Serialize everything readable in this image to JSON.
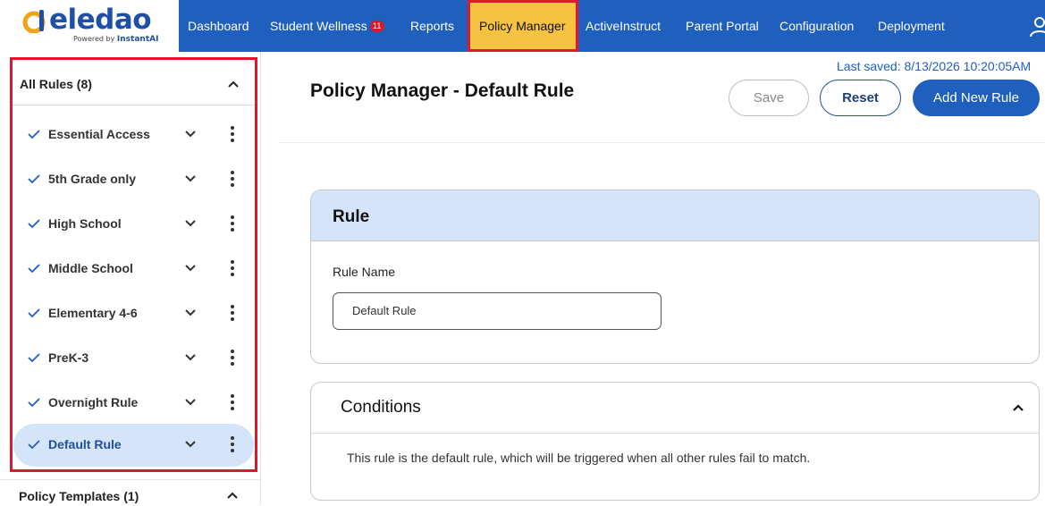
{
  "brand": {
    "name": "eledao",
    "powered_by_prefix": "Powered by",
    "powered_by_name": "InstantAI",
    "logo_icon": "eledao-logo-icon",
    "accent_color": "#1f5fbe",
    "logo_orange": "#f0a21b"
  },
  "nav": {
    "items": [
      {
        "label": "Dashboard"
      },
      {
        "label": "Student Wellness",
        "badge": "11"
      },
      {
        "label": "Reports"
      },
      {
        "label": "Policy Manager",
        "active": true
      },
      {
        "label": "ActiveInstruct"
      },
      {
        "label": "Parent Portal"
      },
      {
        "label": "Configuration"
      },
      {
        "label": "Deployment"
      }
    ],
    "user_icon": "user-icon",
    "active_bg": "#f5c242",
    "active_border": "#e0182d"
  },
  "sidebar": {
    "rules_title": "All Rules (8)",
    "rules": [
      {
        "label": "Essential Access"
      },
      {
        "label": "5th Grade only"
      },
      {
        "label": "High School"
      },
      {
        "label": "Middle School"
      },
      {
        "label": "Elementary 4-6"
      },
      {
        "label": "PreK-3"
      },
      {
        "label": "Overnight Rule"
      },
      {
        "label": "Default Rule",
        "selected": true
      }
    ],
    "templates_title": "Policy Templates (1)",
    "selected_bg": "#d4e5f9"
  },
  "main": {
    "last_saved": "Last saved: 8/13/2026 10:20:05AM",
    "page_title": "Policy Manager - Default Rule",
    "buttons": {
      "save": "Save",
      "reset": "Reset",
      "add": "Add New Rule"
    },
    "rule_card": {
      "title": "Rule",
      "field_label": "Rule Name",
      "field_value": "Default Rule"
    },
    "conditions_card": {
      "title": "Conditions",
      "text": "This rule is the default rule, which will be triggered when all other rules fail to match."
    }
  }
}
